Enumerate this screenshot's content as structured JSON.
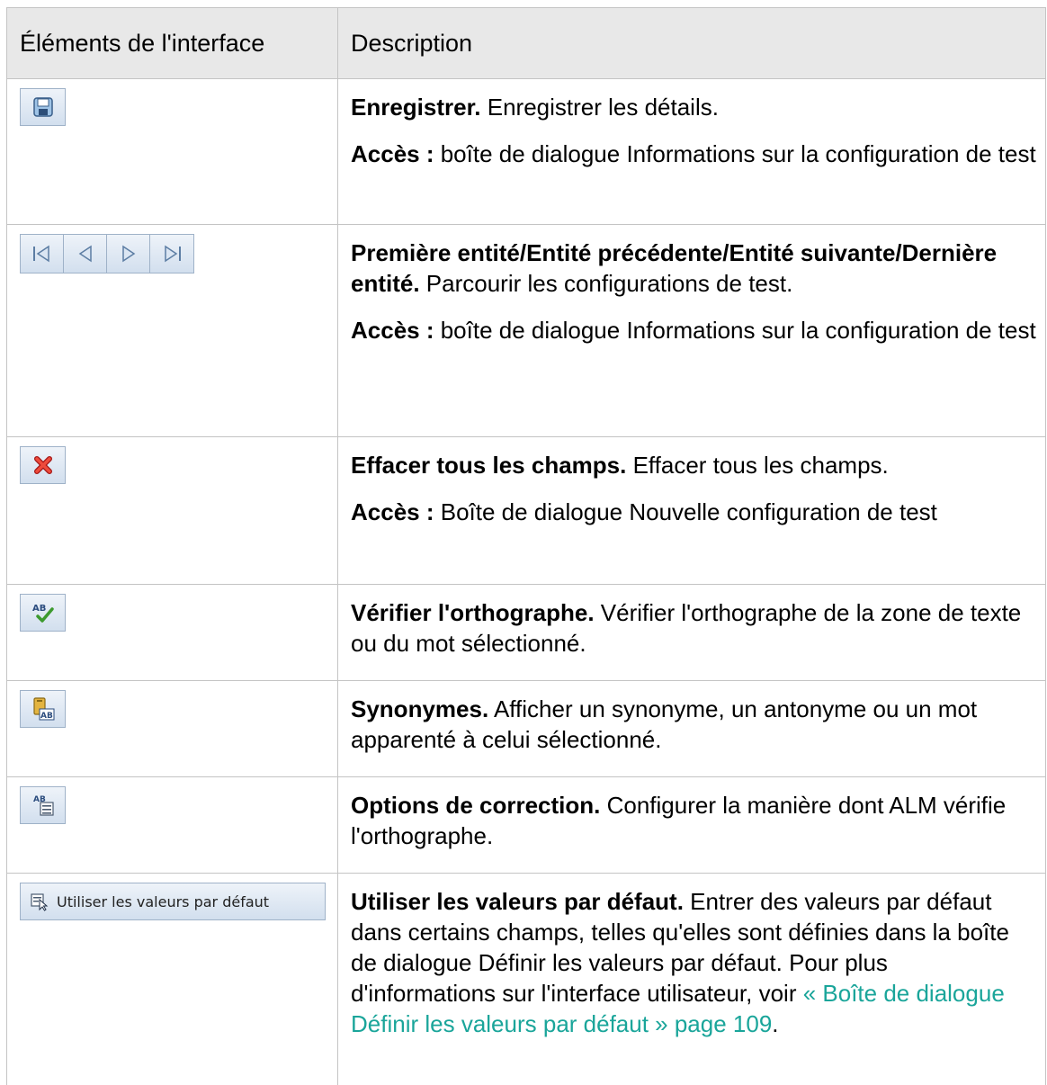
{
  "header": {
    "col1": "Éléments de l'interface",
    "col2": "Description"
  },
  "rows": [
    {
      "icon": "save-icon",
      "title": "Enregistrer.",
      "text": " Enregistrer les détails.",
      "access_label": "Accès :",
      "access_text": " boîte de dialogue Informations sur la configuration de test"
    },
    {
      "icon": "navigation-arrows-icon",
      "title": "Première entité/Entité précédente/Entité suivante/Dernière entité.",
      "text": " Parcourir les configurations de test.",
      "access_label": "Accès :",
      "access_text": " boîte de dialogue Informations sur la configuration de test"
    },
    {
      "icon": "clear-fields-icon",
      "title": "Effacer tous les champs.",
      "text": " Effacer tous les champs.",
      "access_label": "Accès :",
      "access_text": " Boîte de dialogue Nouvelle configuration de test"
    },
    {
      "icon": "spell-check-icon",
      "title": "Vérifier l'orthographe.",
      "text": " Vérifier l'orthographe de la zone de texte ou du mot sélectionné."
    },
    {
      "icon": "thesaurus-icon",
      "title": "Synonymes.",
      "text": " Afficher un synonyme, un antonyme ou un mot apparenté à celui sélectionné."
    },
    {
      "icon": "spelling-options-icon",
      "title": "Options de correction.",
      "text": " Configurer la manière dont ALM vérifie l'orthographe."
    },
    {
      "icon": "default-values-icon",
      "button_label": "Utiliser les valeurs par défaut",
      "title": "Utiliser les valeurs par défaut.",
      "text": " Entrer des valeurs par défaut dans certains champs, telles qu'elles sont définies dans la boîte de dialogue Définir les valeurs par défaut. Pour plus d'informations sur l'interface utilisateur, voir ",
      "link": "« Boîte de dialogue Définir les valeurs par défaut » page 109",
      "text_end": "."
    }
  ],
  "colors": {
    "header_bg": "#e8e8e8",
    "border": "#c4c4c4",
    "link": "#1aa59a"
  }
}
